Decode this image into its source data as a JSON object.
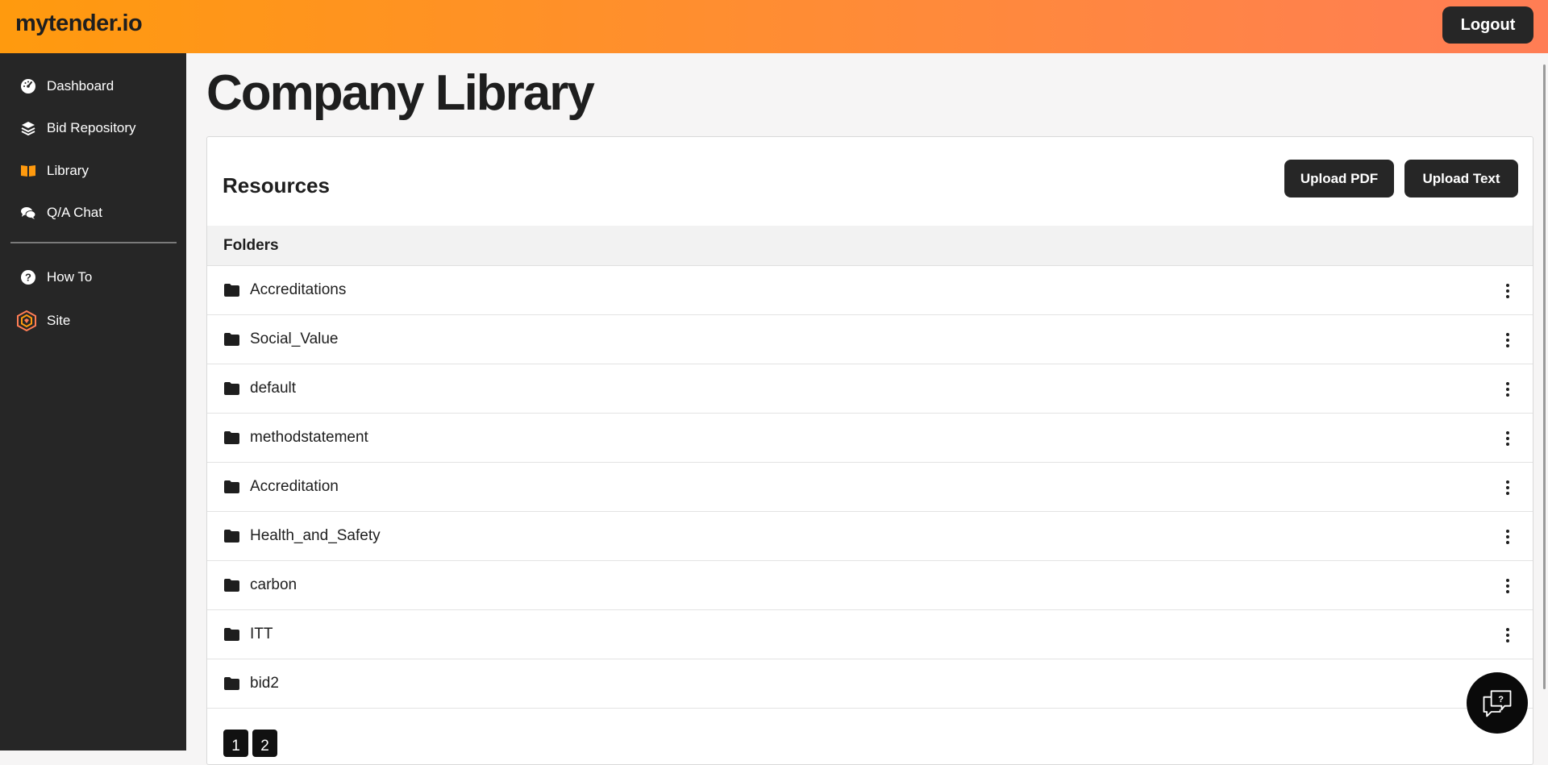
{
  "header": {
    "brand": "mytender.io",
    "logout_label": "Logout",
    "gradient": [
      "#ff9a0e",
      "#ff7d55"
    ]
  },
  "sidebar": {
    "items": [
      {
        "label": "Dashboard",
        "icon": "dashboard-gauge-icon"
      },
      {
        "label": "Bid Repository",
        "icon": "layers-icon"
      },
      {
        "label": "Library",
        "icon": "open-book-icon",
        "active": true
      },
      {
        "label": "Q/A Chat",
        "icon": "chat-bubbles-icon"
      },
      {
        "label": "How To",
        "icon": "question-circle-icon"
      },
      {
        "label": "Site",
        "icon": "hexagon-logo-icon"
      }
    ]
  },
  "main": {
    "title": "Company Library",
    "card": {
      "title": "Resources",
      "upload_pdf_label": "Upload PDF",
      "upload_text_label": "Upload Text",
      "folders_header": "Folders",
      "folders": [
        "Accreditations",
        "Social_Value",
        "default",
        "methodstatement",
        "Accreditation",
        "Health_and_Safety",
        "carbon",
        "ITT",
        "bid2"
      ],
      "pages": [
        "1",
        "2"
      ]
    }
  },
  "colors": {
    "accent": "#ff9a0e",
    "sidebar_bg": "#262626",
    "button_bg": "#262626"
  }
}
